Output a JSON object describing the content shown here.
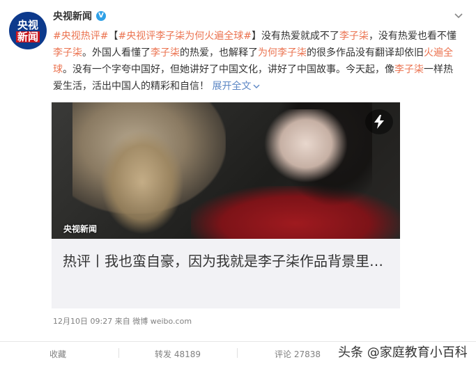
{
  "author": {
    "name": "央视新闻",
    "verified_mark": "V",
    "avatar_line1": "央视",
    "avatar_line2": "新闻"
  },
  "post": {
    "hashtag1": "#央视热评#",
    "bracket_open": "【",
    "hashtag2_prefix": "#央视评",
    "hashtag2_link": "李子柒为何火遍全球",
    "hashtag2_suffix": "#",
    "bracket_close": "】",
    "t1": "没有热爱就成不了",
    "link1": "李子柒",
    "t2": "，没有热爱也看不懂",
    "link2": "李子柒",
    "t3": "。外国人看懂了",
    "link3": "李子柒",
    "t4": "的热爱，也解释了",
    "link4": "为何李子柒",
    "t5": "的很多作品没有翻译却依旧",
    "link5": "火遍全球",
    "t6": "。没有一个字夸中国好，但她讲好了中国文化，讲好了中国故事。今天起，像",
    "link6": "李子柒",
    "t7": "一样热爱生活，活出中国人的精彩和自信！",
    "expand": "展开全文"
  },
  "video": {
    "watermark": "央视新闻"
  },
  "card": {
    "title": "热评丨我也蛮自豪，因为我就是李子柒作品背景里…"
  },
  "meta": {
    "date": "12月10日",
    "time": "09:27",
    "from_label": "来自",
    "source": "微博 weibo.com"
  },
  "actions": {
    "collect": "收藏",
    "repost": "转发 48189",
    "comment": "评论 27838"
  },
  "brand": "头条 @家庭教育小百科"
}
